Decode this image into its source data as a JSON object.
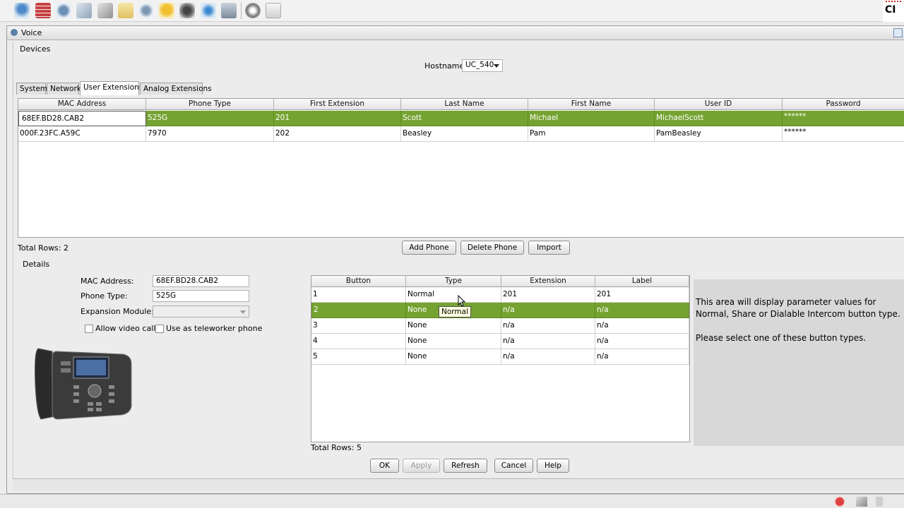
{
  "window": {
    "title": "Voice"
  },
  "devices": {
    "section_label": "Devices",
    "hostname_label": "Hostname:",
    "hostname_value": "UC_540",
    "tabs": [
      "System",
      "Network",
      "User Extensions",
      "Analog Extensions"
    ],
    "active_tab": "User Extensions",
    "columns": [
      "MAC Address",
      "Phone Type",
      "First Extension",
      "Last Name",
      "First Name",
      "User ID",
      "Password"
    ],
    "rows": [
      [
        "68EF.BD28.CAB2",
        "525G",
        "201",
        "Scott",
        "Michael",
        "MichaelScott",
        "******"
      ],
      [
        "000F.23FC.A59C",
        "7970",
        "202",
        "Beasley",
        "Pam",
        "PamBeasley",
        "******"
      ]
    ],
    "total_rows": "Total Rows: 2",
    "buttons": {
      "add_phone": "Add Phone",
      "delete_phone": "Delete Phone",
      "import": "Import"
    }
  },
  "details": {
    "section_label": "Details",
    "mac_label": "MAC Address:",
    "mac_value": "68EF.BD28.CAB2",
    "phone_type_label": "Phone Type:",
    "phone_type_value": "525G",
    "expansion_label": "Expansion Module:",
    "expansion_value": "",
    "allow_video_label": "Allow video calls",
    "teleworker_label": "Use as teleworker phone",
    "button_columns": [
      "Button",
      "Type",
      "Extension",
      "Label"
    ],
    "button_rows": [
      [
        "1",
        "Normal",
        "201",
        "201"
      ],
      [
        "2",
        "None",
        "n/a",
        "n/a"
      ],
      [
        "3",
        "None",
        "n/a",
        "n/a"
      ],
      [
        "4",
        "None",
        "n/a",
        "n/a"
      ],
      [
        "5",
        "None",
        "n/a",
        "n/a"
      ]
    ],
    "tooltip": "Normal",
    "total_rows": "Total Rows: 5",
    "info_line1": "This area will display parameter values for",
    "info_line2": "Normal, Share or Dialable Intercom button type.",
    "info_line3": "Please select one of these button types."
  },
  "footer_buttons": {
    "ok": "OK",
    "apply": "Apply",
    "refresh": "Refresh",
    "cancel": "Cancel",
    "help": "Help"
  },
  "colors": {
    "selection": "#75a331",
    "info_bg": "#d8d8d8"
  }
}
